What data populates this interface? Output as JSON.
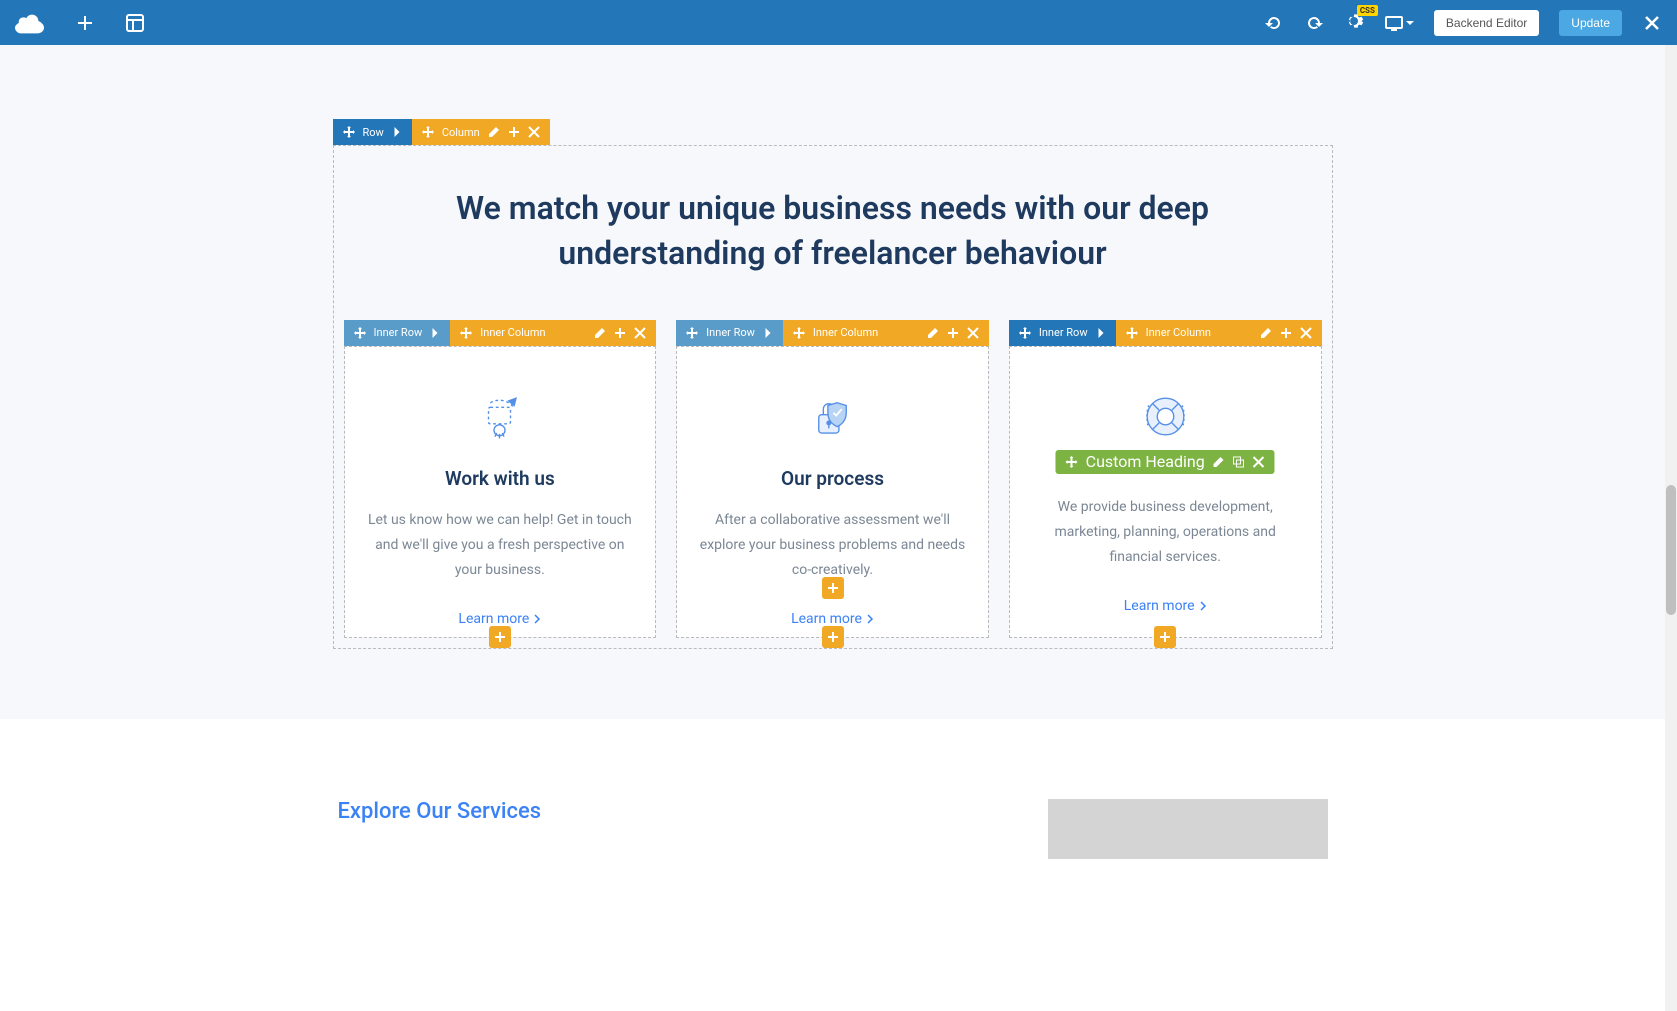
{
  "topbar": {
    "backend_editor_label": "Backend Editor",
    "update_label": "Update"
  },
  "editor": {
    "row_label": "Row",
    "column_label": "Column",
    "inner_row_label": "Inner Row",
    "inner_column_label": "Inner Column",
    "custom_heading_label": "Custom Heading"
  },
  "content": {
    "heading": "We match your unique business needs with our deep understanding of freelancer behaviour",
    "cards": [
      {
        "title": "Work with us",
        "text": "Let us know how we can help! Get in touch and we'll give you a fresh perspective on your business.",
        "link": "Learn more"
      },
      {
        "title": "Our process",
        "text": "After a collaborative assessment we'll explore your business problems and needs co-creatively.",
        "link": "Learn more"
      },
      {
        "title": "",
        "text": "We provide business development, marketing, planning, operations and financial services.",
        "link": "Learn more"
      }
    ],
    "explore_title": "Explore Our Services"
  }
}
